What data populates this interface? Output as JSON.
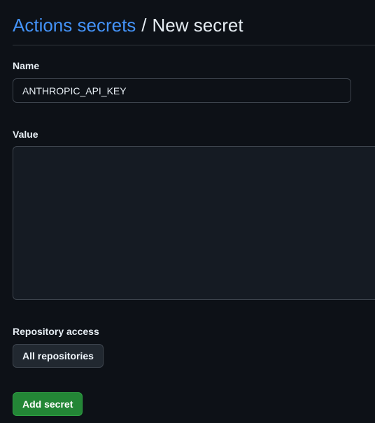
{
  "header": {
    "breadcrumb_link": "Actions secrets",
    "separator": "/",
    "current_page": "New secret"
  },
  "form": {
    "name_label": "Name",
    "name_value": "ANTHROPIC_API_KEY",
    "value_label": "Value",
    "value_text": "",
    "repository_access_label": "Repository access",
    "repository_access_value": "All repositories",
    "submit_label": "Add secret"
  },
  "colors": {
    "background": "#0d1117",
    "link": "#4493f8",
    "primary_button": "#238636",
    "border": "#3d444d"
  }
}
